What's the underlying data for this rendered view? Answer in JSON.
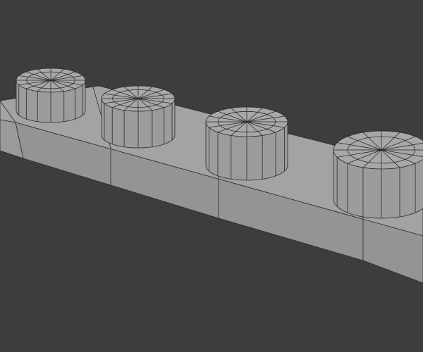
{
  "viewport": {
    "background": "#3d3d3d",
    "face_top": "#a3a3a3",
    "face_front": "#949494",
    "face_side": "#9a9a9a",
    "wire": "#2a2a2a"
  }
}
